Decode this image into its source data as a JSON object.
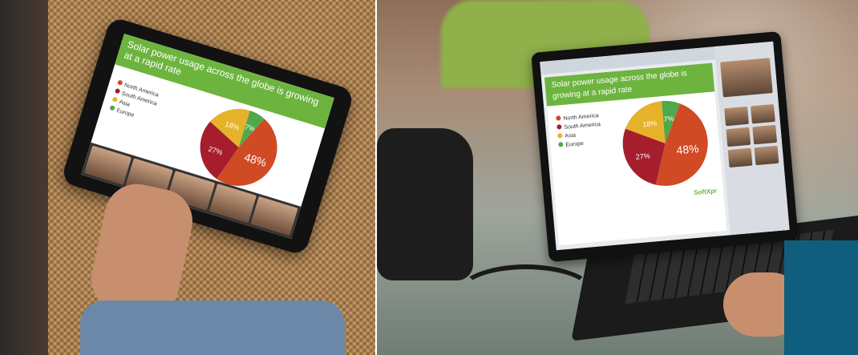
{
  "slide": {
    "title": "Solar power usage across the globe is growing at a rapid rate",
    "legend": [
      "North America",
      "South America",
      "Asia",
      "Europe"
    ],
    "legend_colors": [
      "#d04a24",
      "#a61d2c",
      "#e6b22a",
      "#4fa84a"
    ],
    "slices": [
      {
        "label": "48%",
        "value": 48,
        "color": "#d04a24"
      },
      {
        "label": "27%",
        "value": 27,
        "color": "#a61d2c"
      },
      {
        "label": "18%",
        "value": 18,
        "color": "#e6b22a"
      },
      {
        "label": "7%",
        "value": 7,
        "color": "#4fa84a"
      }
    ],
    "brand": "SoftXpr"
  },
  "colors": {
    "banner": "#6db43f"
  }
}
